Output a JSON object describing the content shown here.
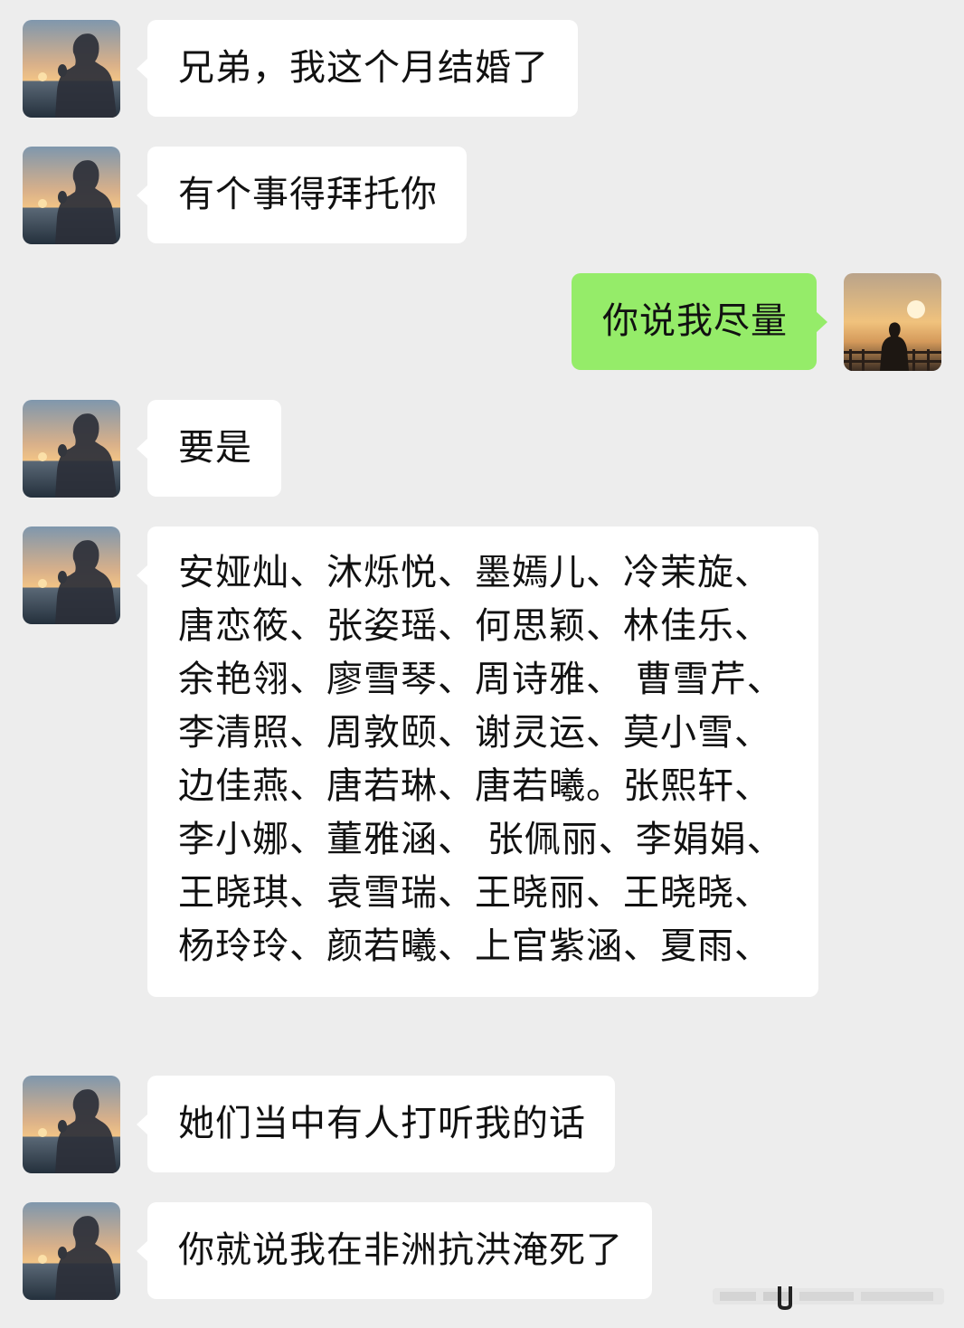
{
  "chat": {
    "background": "#ededed",
    "incoming_bubble_color": "#ffffff",
    "outgoing_bubble_color": "#95ec69",
    "messages": [
      {
        "sender": "friend",
        "text": "兄弟，我这个月结婚了"
      },
      {
        "sender": "friend",
        "text": "有个事得拜托你"
      },
      {
        "sender": "me",
        "text": "你说我尽量"
      },
      {
        "sender": "friend",
        "text": "要是"
      },
      {
        "sender": "friend",
        "text": "安娅灿、沐烁悦、墨嫣儿、冷茉旋、唐恋筱、张姿瑶、何思颖、林佳乐、余艳翎、廖雪琴、周诗雅、 曹雪芹、李清照、周敦颐、谢灵运、莫小雪、边佳燕、唐若琳、唐若曦。张熙轩、李小娜、董雅涵、 张佩丽、李娟娟、王晓琪、袁雪瑞、王晓丽、王晓晓、杨玲玲、颜若曦、上官紫涵、夏雨、"
      },
      {
        "sender": "friend",
        "text": "她们当中有人打听我的话"
      },
      {
        "sender": "friend",
        "text": "你就说我在非洲抗洪淹死了"
      }
    ]
  },
  "avatars": {
    "friend_icon": "man-silhouette-sunset-avatar-icon",
    "me_icon": "man-by-railing-sunset-avatar-icon"
  }
}
